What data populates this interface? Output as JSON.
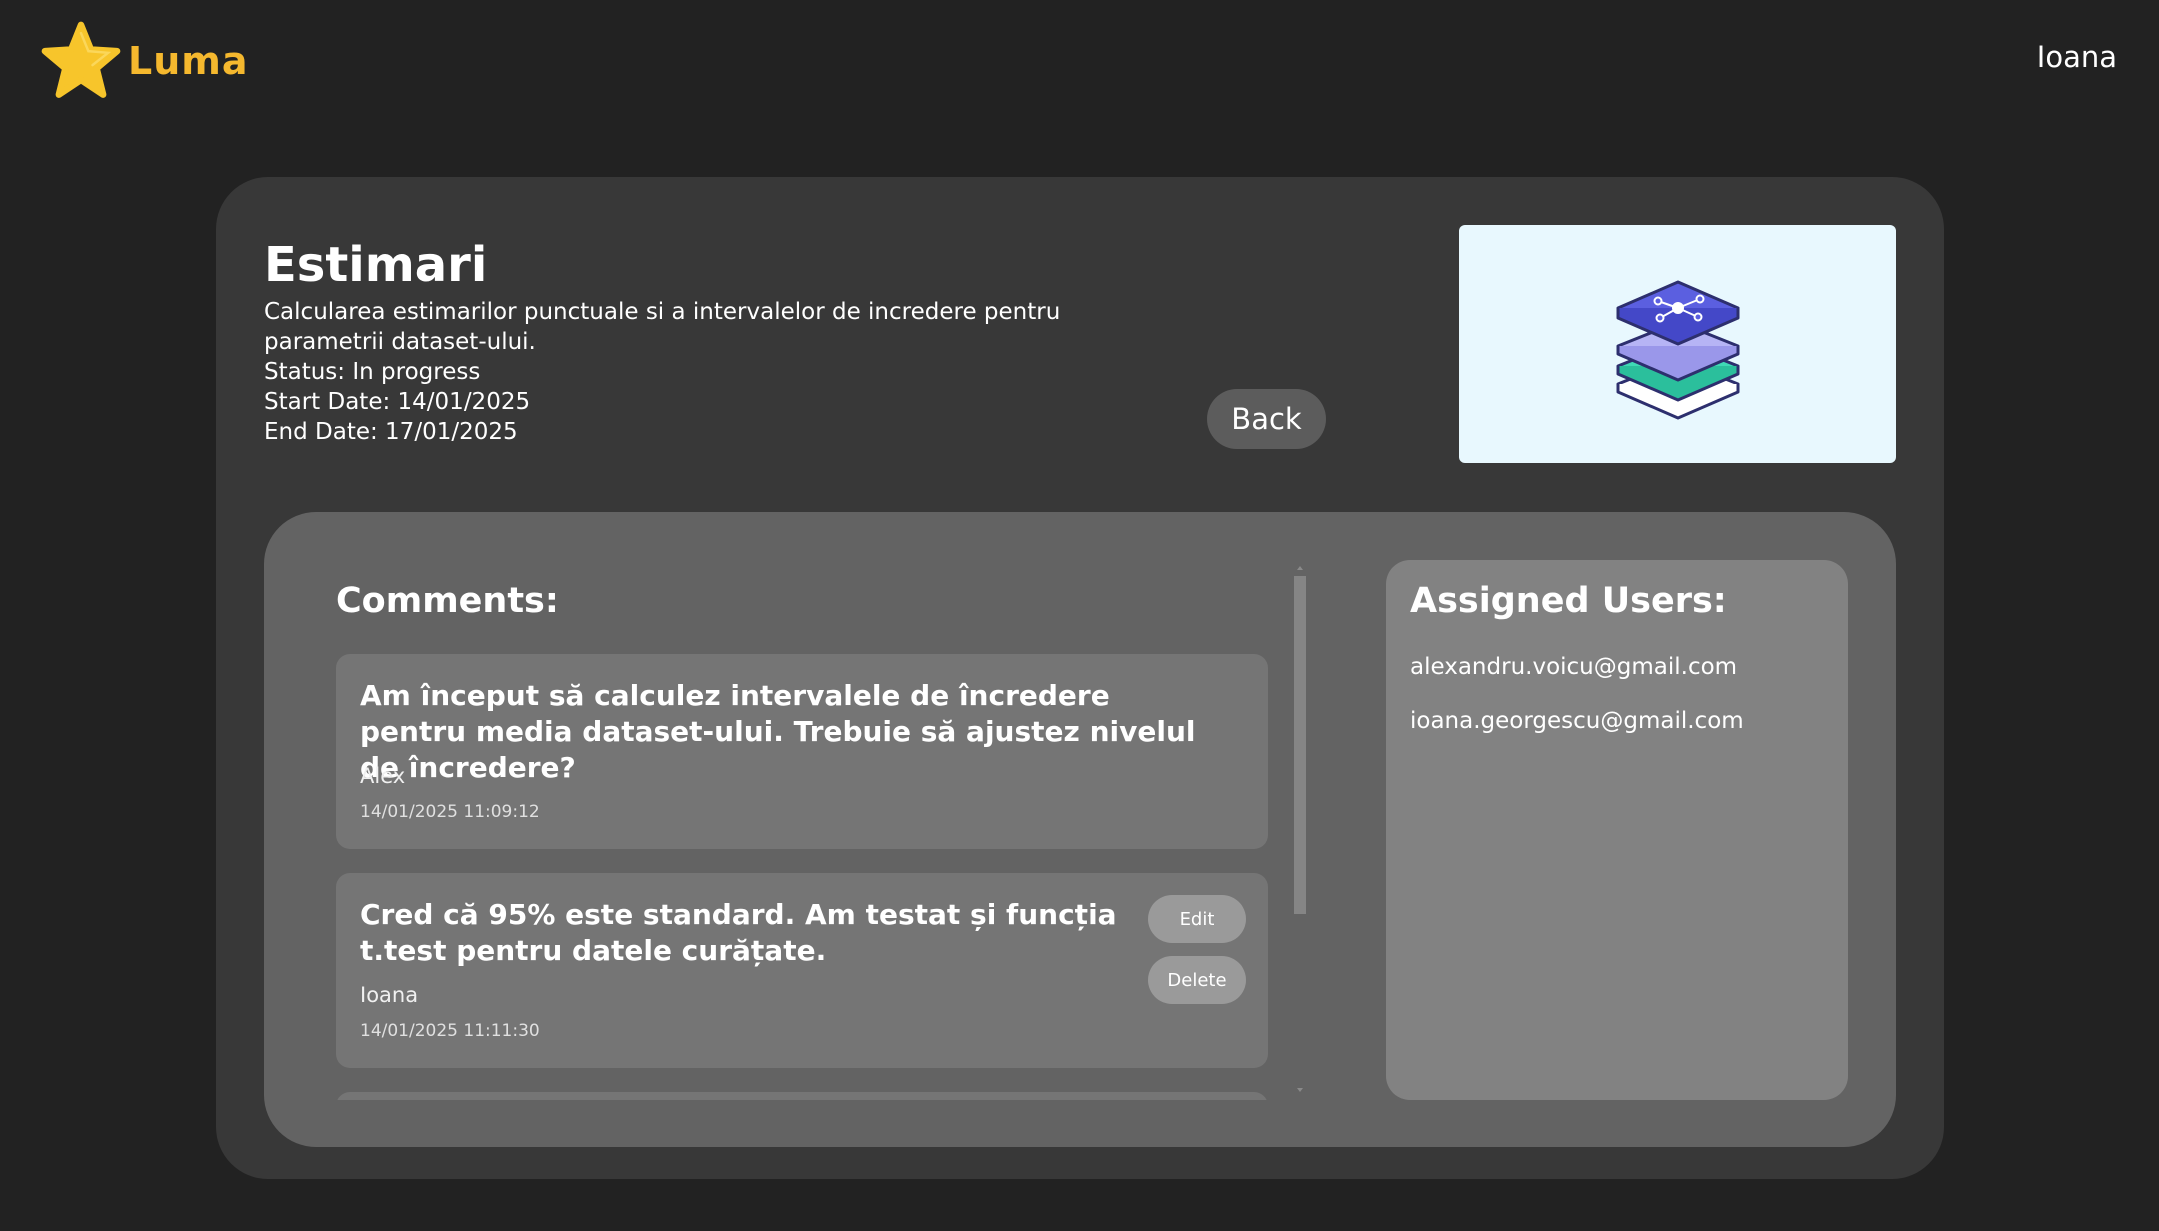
{
  "header": {
    "logo_text": "Luma",
    "user_name": "Ioana"
  },
  "task": {
    "title": "Estimari",
    "description": "Calcularea estimarilor punctuale si a intervalelor de incredere pentru parametrii dataset-ului.",
    "status": "Status: In progress",
    "start_date": "Start Date: 14/01/2025",
    "end_date": "End Date: 17/01/2025",
    "back_label": "Back"
  },
  "comments": {
    "title": "Comments:",
    "items": [
      {
        "text": "Am început să calculez intervalele de încredere pentru media dataset-ului. Trebuie să ajustez nivelul de încredere?",
        "author": "Alex",
        "date": "14/01/2025 11:09:12"
      },
      {
        "text": "Cred că 95% este standard. Am testat și funcția t.test pentru datele curățate.",
        "author": "Ioana",
        "date": "14/01/2025 11:11:30",
        "edit_label": "Edit",
        "delete_label": "Delete"
      }
    ]
  },
  "assigned_users": {
    "title": "Assigned Users:",
    "emails": [
      "alexandru.voicu@gmail.com",
      "ioana.georgescu@gmail.com"
    ]
  },
  "colors": {
    "background": "#222222",
    "card": "#383838",
    "panel": "#636363",
    "comment_card": "#757575",
    "users_panel": "#828282",
    "brand": "#f5b82e",
    "image_bg": "#e8f8fe"
  },
  "icons": {
    "logo": "star-icon",
    "task_image": "layers-stack-icon"
  }
}
